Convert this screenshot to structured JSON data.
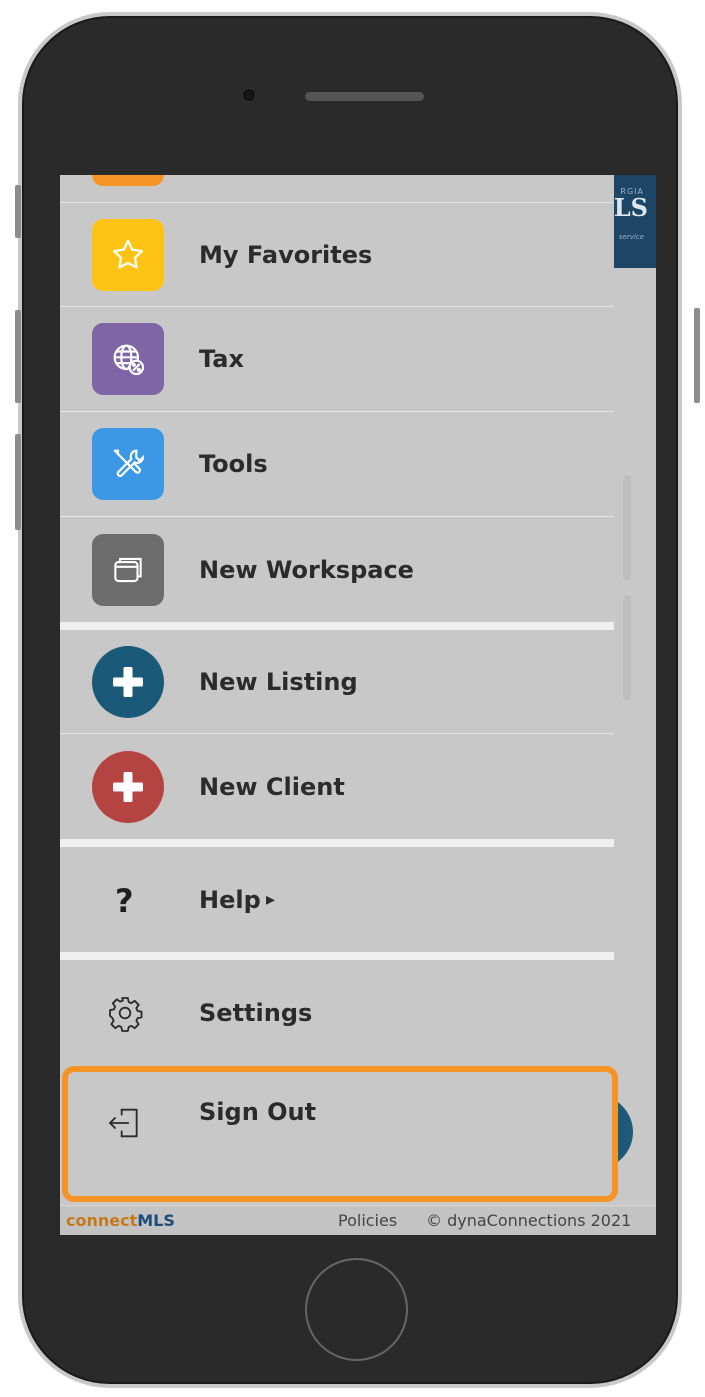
{
  "menu": {
    "items": [
      {
        "label": "My Favorites",
        "icon": "star-icon",
        "color": "#ffc314"
      },
      {
        "label": "Tax",
        "icon": "globe-percent-icon",
        "color": "#7f65a6"
      },
      {
        "label": "Tools",
        "icon": "tools-icon",
        "color": "#3c98e6"
      },
      {
        "label": "New Workspace",
        "icon": "window-icon",
        "color": "#6c6c6c"
      }
    ],
    "new_listing": {
      "label": "New Listing",
      "icon": "plus-circle-icon",
      "color": "#1a5a78"
    },
    "new_client": {
      "label": "New Client",
      "icon": "plus-circle-icon",
      "color": "#b54342"
    },
    "help": {
      "label": "Help",
      "icon": "question-icon",
      "arrow": "▸"
    },
    "settings": {
      "label": "Settings",
      "icon": "gear-icon"
    },
    "sign_out": {
      "label": "Sign Out",
      "icon": "sign-out-icon"
    }
  },
  "footer": {
    "brand_part1": "connect",
    "brand_part2": "MLS",
    "policies": "Policies",
    "copyright": "© dynaConnections 2021"
  },
  "background": {
    "logo_text": "LS",
    "logo_top": "RGIA",
    "logo_sub": "service"
  },
  "colors": {
    "highlight": "#f59424",
    "header": "#1d4566"
  }
}
